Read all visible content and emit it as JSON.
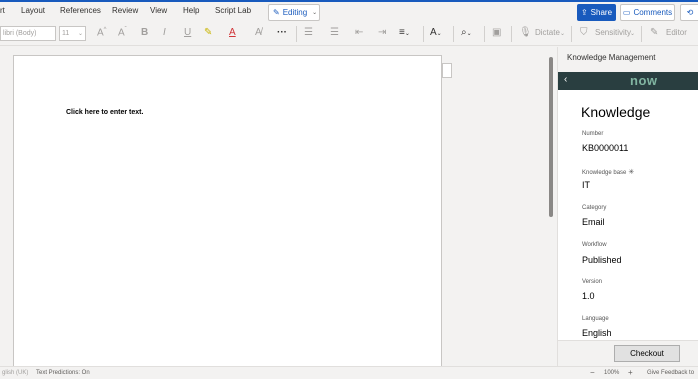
{
  "menu": {
    "items": [
      "rt",
      "Layout",
      "References",
      "Review",
      "View",
      "Help",
      "Script Lab"
    ],
    "editing_label": "Editing",
    "share_label": "Share",
    "comments_label": "Comments"
  },
  "ribbon": {
    "font_name": "libri (Body)",
    "font_size": "11",
    "dictate_label": "Dictate",
    "sensitivity_label": "Sensitivity",
    "editor_label": "Editor"
  },
  "document": {
    "placeholder_text": "Click here to enter text."
  },
  "pane": {
    "header_title": "Knowledge Management",
    "brand_logo": "now",
    "record_title": "Knowledge",
    "fields": [
      {
        "label": "Number",
        "value": "KB0000011"
      },
      {
        "label": "Knowledge base",
        "value": "IT"
      },
      {
        "label": "Category",
        "value": "Email"
      },
      {
        "label": "Workflow",
        "value": "Published"
      },
      {
        "label": "Version",
        "value": "1.0"
      },
      {
        "label": "Language",
        "value": "English"
      }
    ],
    "checkout_label": "Checkout"
  },
  "status": {
    "language": "glish (UK)",
    "text_predictions": "Text Predictions: On",
    "zoom_minus": "−",
    "zoom_level": "100%",
    "zoom_plus": "+",
    "feedback": "Give Feedback to"
  },
  "colors": {
    "brand_blue": "#185abd",
    "servicenow_bar": "#293e40",
    "servicenow_logo": "#81b5a1"
  }
}
